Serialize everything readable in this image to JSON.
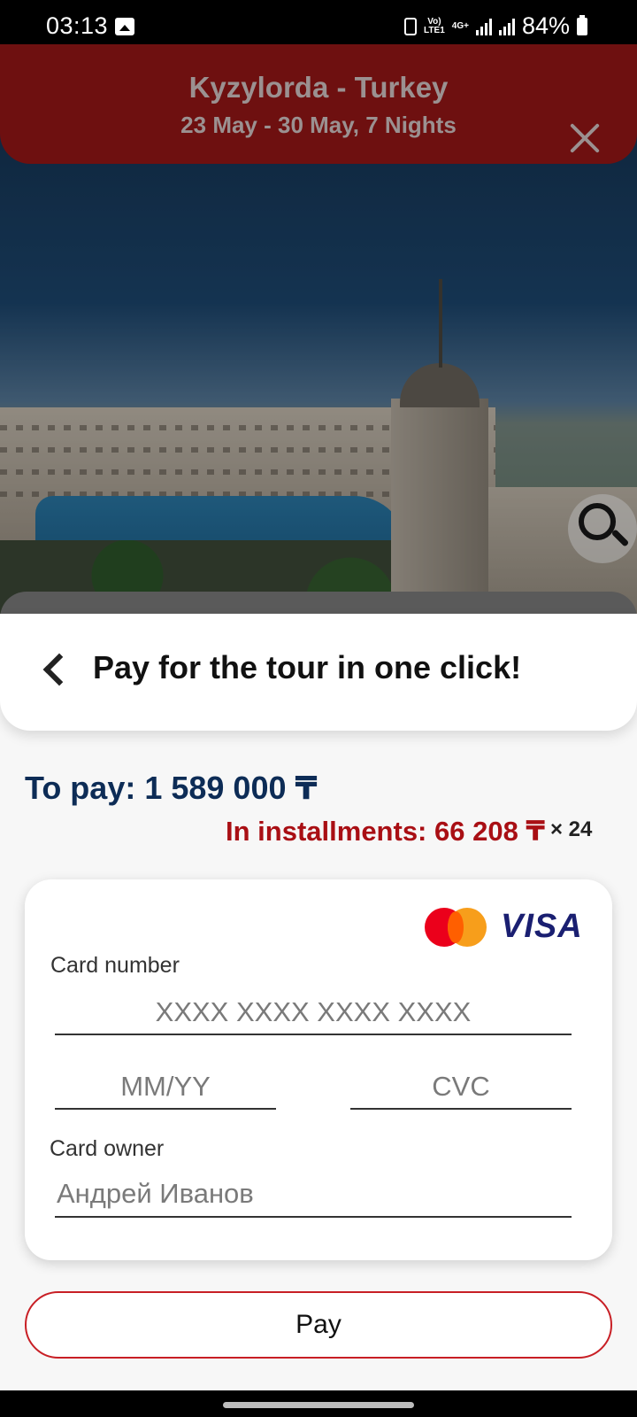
{
  "status_bar": {
    "time": "03:13",
    "network_top": "Vo)",
    "network_bottom": "LTE1",
    "data_type": "4G+",
    "battery": "84%"
  },
  "header": {
    "title": "Kyzylorda - Turkey",
    "subtitle": "23 May - 30 May, 7 Nights"
  },
  "sheet": {
    "title": "Pay for the tour in one click!",
    "to_pay": "To pay: 1 589 000 ₸",
    "installments": "In installments: 66 208 ₸",
    "installments_count": "× 24"
  },
  "card_form": {
    "brands": [
      "mastercard",
      "VISA"
    ],
    "card_number_label": "Card number",
    "card_number_placeholder": "XXXX XXXX XXXX XXXX",
    "expiry_placeholder": "MM/YY",
    "cvc_placeholder": "CVC",
    "owner_label": "Card owner",
    "owner_placeholder": "Андрей Иванов"
  },
  "actions": {
    "pay_label": "Pay"
  },
  "colors": {
    "header_red_dimmed": "#6e1010",
    "amount_navy": "#0d2c56",
    "installment_red": "#a90f14",
    "pay_border": "#c81f25"
  },
  "icons": [
    "gallery-icon",
    "sim-icon",
    "signal-icon",
    "battery-icon",
    "close-icon",
    "zoom-icon",
    "back-chevron-icon",
    "mastercard-icon",
    "visa-logo"
  ]
}
